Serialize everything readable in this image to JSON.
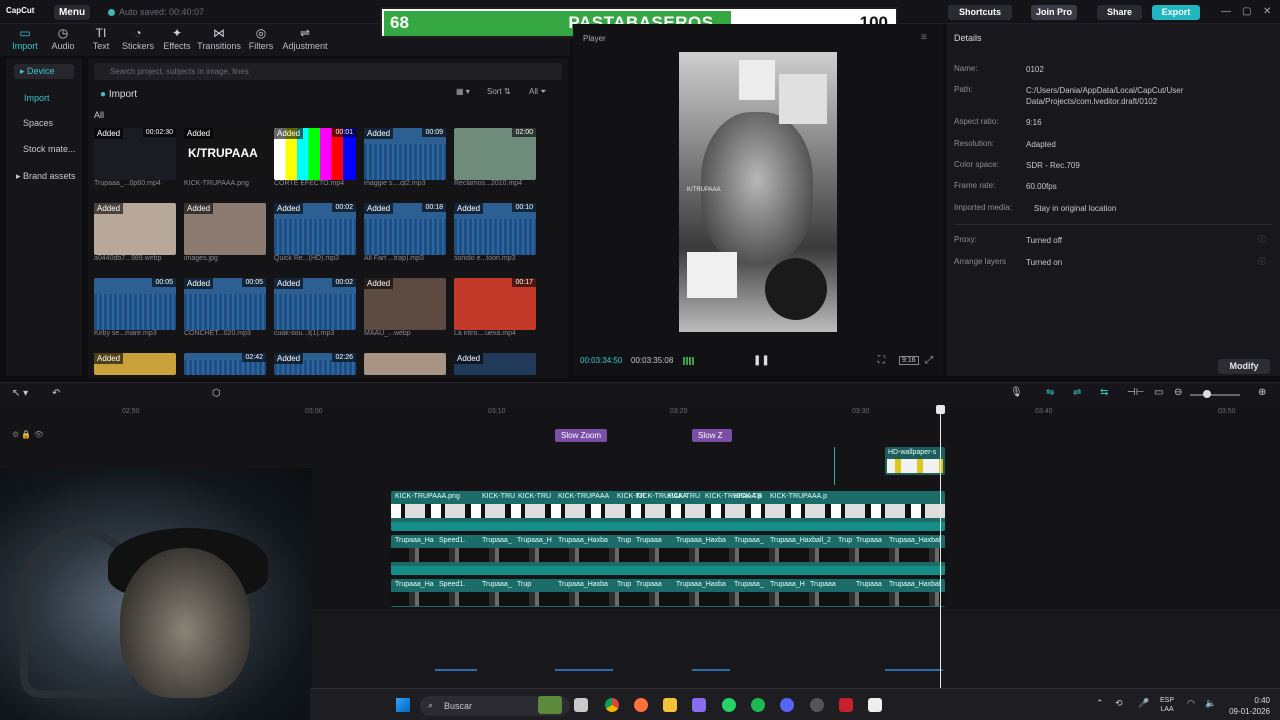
{
  "titlebar": {
    "logo": "CapCut",
    "menu": "Menu",
    "autosave": "Auto saved: 00:40:07",
    "shortcuts": "Shortcuts",
    "join_pro": "Join Pro",
    "share": "Share",
    "export": "Export"
  },
  "overlay": {
    "left_score": "68",
    "title": "PASTABASEROS",
    "right_score": "100",
    "progress_fraction": 0.68
  },
  "toolbar": {
    "tools": [
      {
        "label": "Import",
        "icon": "import-icon"
      },
      {
        "label": "Audio",
        "icon": "audio-icon"
      },
      {
        "label": "Text",
        "icon": "text-icon"
      },
      {
        "label": "Stickers",
        "icon": "stickers-icon"
      },
      {
        "label": "Effects",
        "icon": "effects-icon"
      },
      {
        "label": "Transitions",
        "icon": "transitions-icon"
      },
      {
        "label": "Filters",
        "icon": "filters-icon"
      },
      {
        "label": "Adjustment",
        "icon": "adjustment-icon"
      }
    ]
  },
  "leftnav": {
    "device": "Device",
    "import": "Import",
    "spaces": "Spaces",
    "stock": "Stock mate...",
    "brand": "Brand assets"
  },
  "media": {
    "search_placeholder": "Search project, subjects in image, lines",
    "import_label": "Import",
    "all_label": "All",
    "sort": "Sort",
    "filter_all": "All",
    "items": [
      {
        "added": "Added",
        "dur": "00:02:30",
        "name": "Trupaaa_...0p60.mp4"
      },
      {
        "added": "Added",
        "dur": "",
        "name": "KICK-TRUPAAA.png"
      },
      {
        "added": "Added",
        "dur": "00:01",
        "name": "CORTE EFECTO.mp4"
      },
      {
        "added": "Added",
        "dur": "00:09",
        "name": "maggie s....qt2.mp3"
      },
      {
        "added": "",
        "dur": "02:00",
        "name": "Reclamos...2010.mp4"
      },
      {
        "added": "Added",
        "dur": "",
        "name": "a0440db7...989.webp"
      },
      {
        "added": "Added",
        "dur": "",
        "name": "images.jpg"
      },
      {
        "added": "Added",
        "dur": "00:02",
        "name": "Quick Re...(HD).mp3"
      },
      {
        "added": "Added",
        "dur": "00:18",
        "name": "All Fart ...trap).mp3"
      },
      {
        "added": "Added",
        "dur": "00:10",
        "name": "sonido e...toon.mp3"
      },
      {
        "added": "",
        "dur": "00:05",
        "name": "Kirby se...mare.mp3"
      },
      {
        "added": "Added",
        "dur": "00:05",
        "name": "CONCHET...020.mp3"
      },
      {
        "added": "Added",
        "dur": "00:02",
        "name": "cuak-sou...t(1).mp3"
      },
      {
        "added": "Added",
        "dur": "",
        "name": "MAAU_...webp"
      },
      {
        "added": "",
        "dur": "00:17",
        "name": "La intro....ueva.mp4"
      },
      {
        "added": "Added",
        "dur": "",
        "name": ""
      },
      {
        "added": "",
        "dur": "02:42",
        "name": ""
      },
      {
        "added": "Added",
        "dur": "02:26",
        "name": ""
      },
      {
        "added": "",
        "dur": "",
        "name": ""
      },
      {
        "added": "Added",
        "dur": "",
        "name": ""
      }
    ],
    "thumb_text_1": "K/TRUPAAA"
  },
  "player": {
    "label": "Player",
    "current": "00:03:34:50",
    "total": "00:03:35:08",
    "watermark": "K/TRUPAAA",
    "ratio": "9:16"
  },
  "details": {
    "title": "Details",
    "rows": [
      {
        "k": "Name:",
        "v": "0102"
      },
      {
        "k": "Path:",
        "v": "C:/Users/Dania/AppData/Local/CapCut/User Data/Projects/com.lveditor.draft/0102"
      },
      {
        "k": "Aspect ratio:",
        "v": "9:16"
      },
      {
        "k": "Resolution:",
        "v": "Adapted"
      },
      {
        "k": "Color space:",
        "v": "SDR - Rec.709"
      },
      {
        "k": "Frame rate:",
        "v": "60.00fps"
      },
      {
        "k": "Imported media:",
        "v": "Stay in original location"
      },
      {
        "k": "Proxy:",
        "v": "Turned off"
      },
      {
        "k": "Arrange layers",
        "v": "Turned on"
      }
    ],
    "modify": "Modify"
  },
  "timeline": {
    "ruler": [
      "02:50",
      "03:00",
      "03:10",
      "03:20",
      "03:30",
      "03:40",
      "03:50"
    ],
    "fx": [
      "Slow Zoom",
      "Slow Z"
    ],
    "overlay_clip": "HD-wallpaper-s",
    "track1": [
      "KICK-TRUPAAA.png",
      "KICK-TRU",
      "KICK-TRU",
      "KICK-TRUPAAA",
      "KICK-TR",
      "KICK-TRUPAAA",
      "KICK-TRU",
      "KICK-TRUPAAA.p",
      "KICK-TR",
      "KICK-TRUPAAA.p"
    ],
    "track2": [
      "Trupaaa_Ha",
      "Speed1.",
      "Trupaaa_",
      "Trupaaa_H",
      "Trupaaa_Haxba",
      "Trup",
      "Trupaaa",
      "Trupaaa_Haxba",
      "Trupaaa_",
      "Trupaaa_Haxball_2",
      "Trup",
      "Trupaaa",
      "Trupaaa_Haxbal"
    ],
    "track3": [
      "Trupaaa_Ha",
      "Speed1.",
      "Trupaaa_",
      "Trup",
      "Trupaaa_Haxba",
      "Trup",
      "Trupaaa",
      "Trupaaa_Haxba",
      "Trupaaa_",
      "Trupaaa_H",
      "Trupaaa",
      "Trupaaa",
      "Trupaaa_Haxbal"
    ]
  },
  "taskbar": {
    "search": "Buscar",
    "lang1": "ESP",
    "lang2": "LAA",
    "time": "0:40",
    "date": "09-01-2026"
  },
  "colors": {
    "accent": "#36c6d0",
    "score_green": "#35a843",
    "track": "#1b6c68",
    "fx": "#7b4ea8"
  }
}
